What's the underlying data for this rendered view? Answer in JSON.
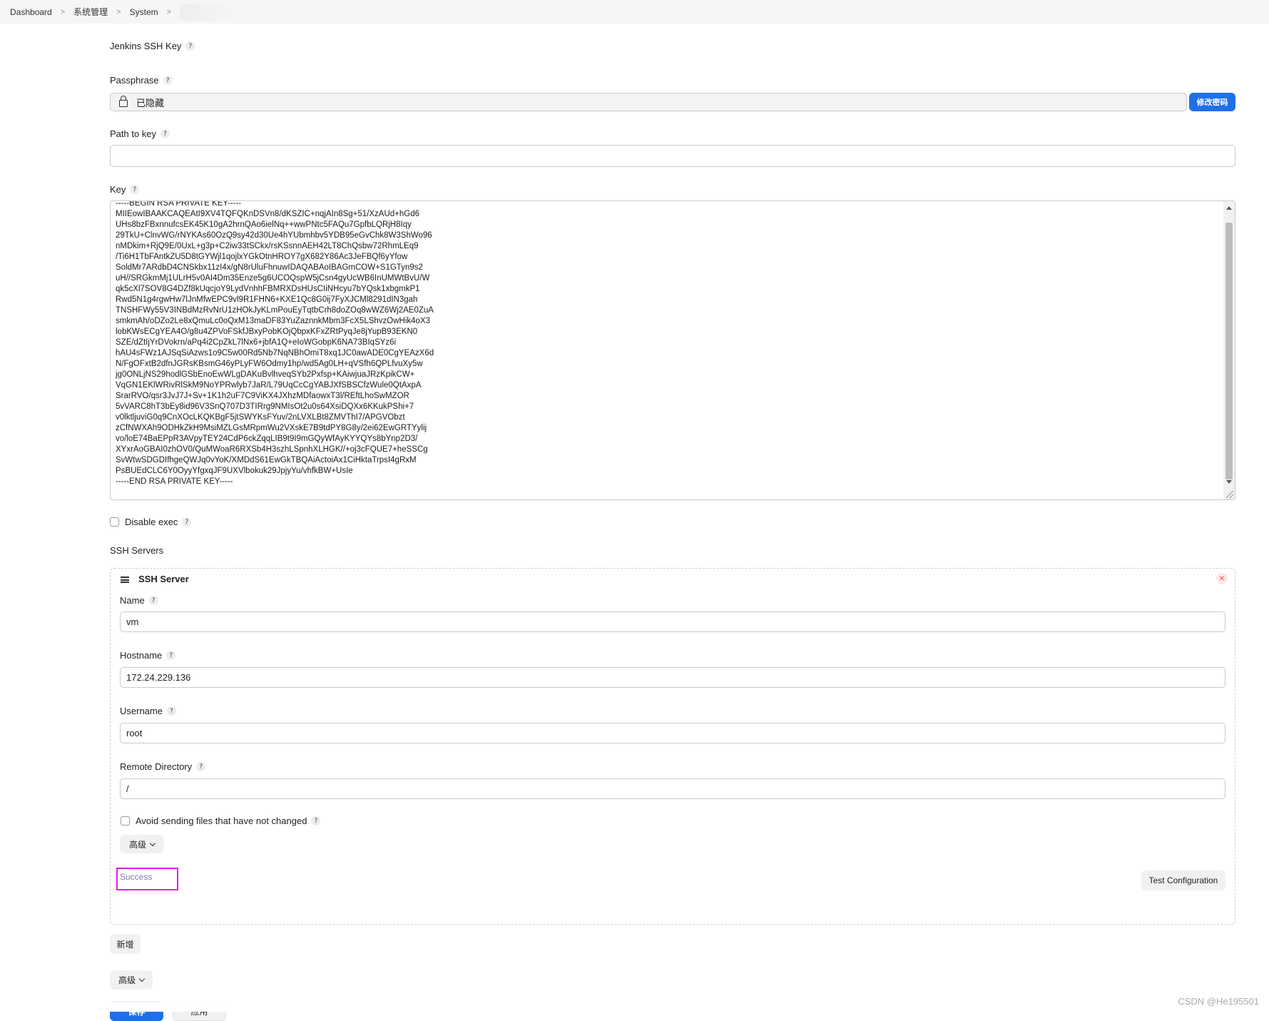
{
  "breadcrumb": {
    "items": [
      "Dashboard",
      "系统管理",
      "System"
    ]
  },
  "fields": {
    "ssh_key_label": "Jenkins SSH Key",
    "passphrase_label": "Passphrase",
    "passphrase_value": "已隐藏",
    "change_password_button": "修改密码",
    "path_to_key_label": "Path to key",
    "path_to_key_value": "",
    "key_label": "Key",
    "key_lines": [
      "-----BEGIN RSA PRIVATE KEY-----",
      "MIIEowIBAAKCAQEAtI9XV4TQFQKnDSVn8/dKSZIC+nqjAIn8Sg+51/XzAUd+hGd6",
      "UHs8bzFBxnnufcsEK45K10gA2hrnQAo6ielNq++wwPNtc5FAQu7GpfbLQRjH8Iqy",
      "29TkU+ClnvWG/rNYKAs60OzQ9sy42d30Ue4hYUbmhbv5YDB95eGvChk8W3ShWo96",
      "nMDkim+RjQ9E/0UxL+g3p+C2iw33tSCkx/rsKSsnnAEH42LT8ChQsbw72RhmLEq9",
      "/Ti6H1TbFAntkZU5D8tGYWjl1qojlxYGkOtnHROY7gX682Y86Ac3JeFBQf6yYfow",
      "SoldMr7ARdbD4CNSkbx11zI4x/gN8rUluFhnuwIDAQABAoIBAGmCOW+S1GTyn9s2",
      "uH//SRGkmMj1ULrH5v0AI4Dm35Enze5g6UCOQspW5jCsn4gyUcWB6InUMWtBvU/W",
      "qk5cXl7SOV8G4DZf8kUqcjoY9LydVnhhFBMRXDsHUsCIiNHcyu7bYQsk1xbgmkP1",
      "Rwd5N1g4rgwHw7lJnMfwEPC9vl9R1FHN6+KXE1Qc8G0ij7FyXJCMl8291dIN3gah",
      "TNSHFWy55V3INBdMzRvNrU1zHOkJyKLmPouEyTqtbCrh8doZOq8wWZ6Wj2AE0ZuA",
      "smkmAh/oDZo2Le8xQmuLc0oQxM13maDF83YuZaznnkMbm3FcX5LShvzOwHik4oX3",
      "lobKWsECgYEA4O/g8u4ZPVoFSkfJBxyPobKOjQbpxKFxZRtPyqJe8jYupB93EKN0",
      "SZE/dZtIjYrDVokrn/aPq4i2CpZkL7lNx6+jbfA1Q+eIoWGobpK6NA73BIqSYz6i",
      "hAU4sFWz1AJSqSiAzws1o9C5w00Rd5Nb7NqNBhOmiT8xq1JC0awADE0CgYEAzX6d",
      "N/FgOFxtB2dfnJGRsKBsmG46yPLyFW6Odmy1hp/wd5Ag0LH+qVSfh6QPLfvuXy5w",
      "jg0ONLjNS29hodlGSbEnoEwWLgDAKuBvlhveqSYb2Pxfsp+KAiwjuaJRzKpikCW+",
      "VqGN1EKlWRivRlSkM9NoYPRwlyb7JaR/L79UqCcCgYABJXfSBSCfzWule0QtAxpA",
      "SrarRVO/qsr3JvJ7J+Sv+1K1h2uF7C9ViKX4JXhzMDfaowxT3l/REftLhoSwMZOR",
      "5vVARC8hT3bEy8id96V3SnQ707D3TIRrg9NMIsOt2u0s64XsiDQXx6KKukPShi+7",
      "v0lktljuviG0q9CnXOcLKQKBgF5jtSWYKsFYuv/2nLVXLBt8ZMVThI7/APGVObzt",
      "zCfNWXAh9ODHkZkH9MsiMZLGsMRpmWu2VXskE7B9tdPY8G8y/2ei62EwGRTYylij",
      "vo/loE74BaEPpR3AVpyTEY24CdP6ckZqqLIB9t9I9mGQyWfAyKYYQYs8bYnp2D3/",
      "XYxrAoGBAI0zhOV0/QuMWoaR6RXSb4H3szhLSpnhXLHGK//+oj3cFQUE7+heSSCg",
      "SvWtwSDGDIfhgeQWJq0vYoK/XMDdS61EwGkTBQAiActoiAx1CiHktaTrpsI4gRxM",
      "PsBUEdCLC6Y0OyyYfgxqJF9UXVlbokuk29JpjyYu/vhfkBW+UsIe",
      "-----END RSA PRIVATE KEY-----"
    ],
    "disable_exec_label": "Disable exec",
    "disable_exec_checked": false
  },
  "ssh_servers": {
    "section_label": "SSH Servers",
    "panel_title": "SSH Server",
    "name_label": "Name",
    "name_value": "vm",
    "hostname_label": "Hostname",
    "hostname_value": "172.24.229.136",
    "username_label": "Username",
    "username_value": "root",
    "remote_dir_label": "Remote Directory",
    "remote_dir_value": "/",
    "avoid_sending_label": "Avoid sending files that have not changed",
    "avoid_sending_checked": false,
    "advanced_label": "高级",
    "status_text": "Success",
    "test_config_button": "Test Configuration",
    "add_button": "新增"
  },
  "footer": {
    "advanced_label": "高级",
    "save_button": "保存",
    "apply_button": "应用",
    "watermark": "CSDN @He195501"
  },
  "colors": {
    "primary": "#1e6fe8",
    "highlight_border": "#e31ae3",
    "success_text": "#7a7ab2"
  }
}
